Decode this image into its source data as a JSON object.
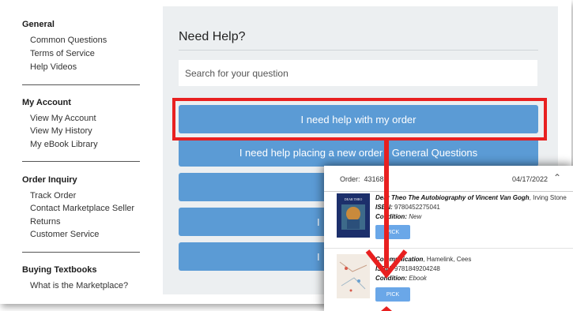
{
  "sidebar": {
    "sections": [
      {
        "title": "General",
        "items": [
          "Common Questions",
          "Terms of Service",
          "Help Videos"
        ]
      },
      {
        "title": "My Account",
        "items": [
          "View My Account",
          "View My History",
          "My eBook Library"
        ]
      },
      {
        "title": "Order Inquiry",
        "items": [
          "Track Order",
          "Contact Marketplace Seller",
          "Returns",
          "Customer Service"
        ]
      },
      {
        "title": "Buying Textbooks",
        "items": [
          "What is the Marketplace?"
        ]
      }
    ]
  },
  "main": {
    "title": "Need Help?",
    "search_placeholder": "Search for your question",
    "buttons": [
      "I need help with my order",
      "I need help placing a new order - General Questions",
      "",
      "I",
      "I"
    ]
  },
  "order_panel": {
    "order_label": "Order:",
    "order_number": "431686",
    "date": "04/17/2022",
    "books": [
      {
        "title_line": "Dear Theo The Autobiography of Vincent Van Gogh",
        "author": ", Irving Stone",
        "isbn_label": "ISBN:",
        "isbn": "9780452275041",
        "condition_label": "Condition:",
        "condition": "New",
        "pick": "PICK",
        "cover_text": "DEAR THEO"
      },
      {
        "title_line": "Communication",
        "author": ", Hamelink, Cees",
        "isbn_label": "ISBN:",
        "isbn": "9781849204248",
        "condition_label": "Condition:",
        "condition": "Ebook",
        "pick": "PICK",
        "cover_text": ""
      }
    ]
  },
  "colors": {
    "button_blue": "#5b9bd5",
    "highlight_red": "#e82020",
    "panel_bg": "#eceff1"
  }
}
